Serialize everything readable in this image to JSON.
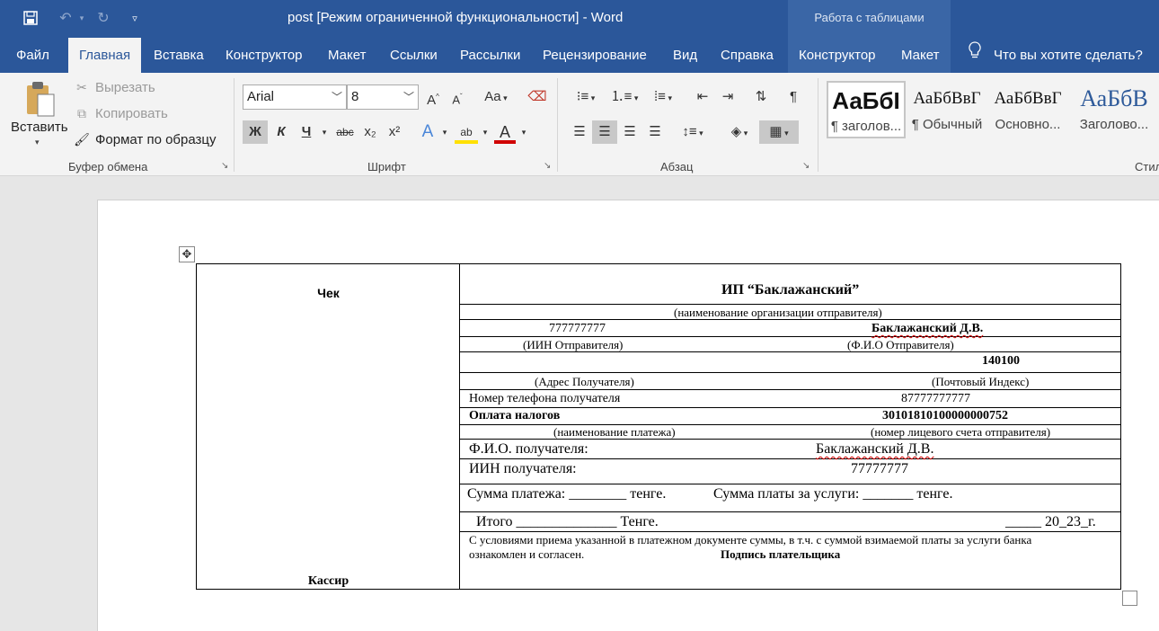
{
  "titlebar": {
    "doc_title": "post [Режим ограниченной функциональности]  -  Word",
    "table_tools": "Работа с таблицами"
  },
  "tabs": [
    "Файл",
    "Главная",
    "Вставка",
    "Конструктор",
    "Макет",
    "Ссылки",
    "Рассылки",
    "Рецензирование",
    "Вид",
    "Справка",
    "Конструктор",
    "Макет"
  ],
  "active_tab": "Главная",
  "tell_me": "Что вы хотите сделать?",
  "clipboard": {
    "paste": "Вставить",
    "cut": "Вырезать",
    "copy": "Копировать",
    "format_painter": "Формат по образцу",
    "label": "Буфер обмена"
  },
  "font": {
    "name": "Arial",
    "size": "8",
    "label": "Шрифт",
    "grow": "A",
    "shrink": "A",
    "case": "Aa",
    "bold": "Ж",
    "italic": "К",
    "underline": "Ч",
    "strike": "abc",
    "subscript": "x₂",
    "superscript": "x²",
    "text_effects": "A",
    "highlight": "ab",
    "font_color": "A"
  },
  "paragraph": {
    "label": "Абзац"
  },
  "styles": {
    "label": "Стил",
    "items": [
      {
        "preview": "АаБбI",
        "name": "¶ заголов..."
      },
      {
        "preview": "АаБбВвГ",
        "name": "¶ Обычный"
      },
      {
        "preview": "АаБбВвГ",
        "name": "Основно..."
      },
      {
        "preview": "АаБбВ",
        "name": "Заголово..."
      }
    ]
  },
  "form": {
    "cheque": "Чек",
    "cashier": "Кассир",
    "org_name": "ИП “Баклажанский”",
    "org_caption": "(наименование организации отправителя)",
    "sender_iin": "777777777",
    "sender_name": "Баклажанский Д.В.",
    "sender_iin_caption": "(ИИН Отправителя)",
    "sender_name_caption": "(Ф.И.О Отправителя)",
    "postal_code": "140100",
    "address_caption": "(Адрес Получателя)",
    "postal_caption": "(Почтовый Индекс)",
    "phone_label": "Номер телефона получателя",
    "phone_value": "87777777777",
    "payment_name": "Оплата налогов",
    "account_number": "30101810100000000752",
    "payment_caption": "(наименование платежа)",
    "account_caption": "(номер лицевого счета отправителя)",
    "recipient_name_label": "Ф.И.О. получателя:",
    "recipient_name": "Баклажанский Д.В.",
    "recipient_iin_label": "ИИН получателя:",
    "recipient_iin": "77777777",
    "sum_line": "Сумма платежа: ________ тенге.",
    "fee_line": "Сумма платы за услуги: _______ тенге.",
    "total_line": "Итого ______________ Тенге.",
    "date_line": "_____ 20_23_г.",
    "terms": "С условиями приема указанной в платежном документе суммы, в т.ч. с суммой взимаемой платы за услуги банка",
    "terms2": "ознакомлен и согласен.",
    "signature": "Подпись плательщика"
  }
}
